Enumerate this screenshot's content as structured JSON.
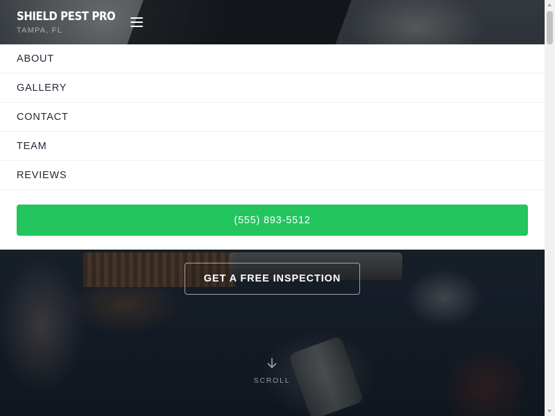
{
  "brand": {
    "name": "SHIELD PEST PRO",
    "location": "TAMPA, FL"
  },
  "header": {
    "menu_icon": "hamburger-icon"
  },
  "nav": {
    "items": [
      {
        "label": "ABOUT"
      },
      {
        "label": "GALLERY"
      },
      {
        "label": "CONTACT"
      },
      {
        "label": "TEAM"
      },
      {
        "label": "REVIEWS"
      }
    ],
    "phone_label": "(555) 893-5512"
  },
  "hero": {
    "cta_label": "GET A FREE INSPECTION",
    "scroll_label": "SCROLL",
    "scroll_icon": "arrow-down-icon"
  },
  "colors": {
    "accent_green": "#22c55e",
    "nav_text": "#1f2937",
    "panel_bg": "#ffffff"
  }
}
